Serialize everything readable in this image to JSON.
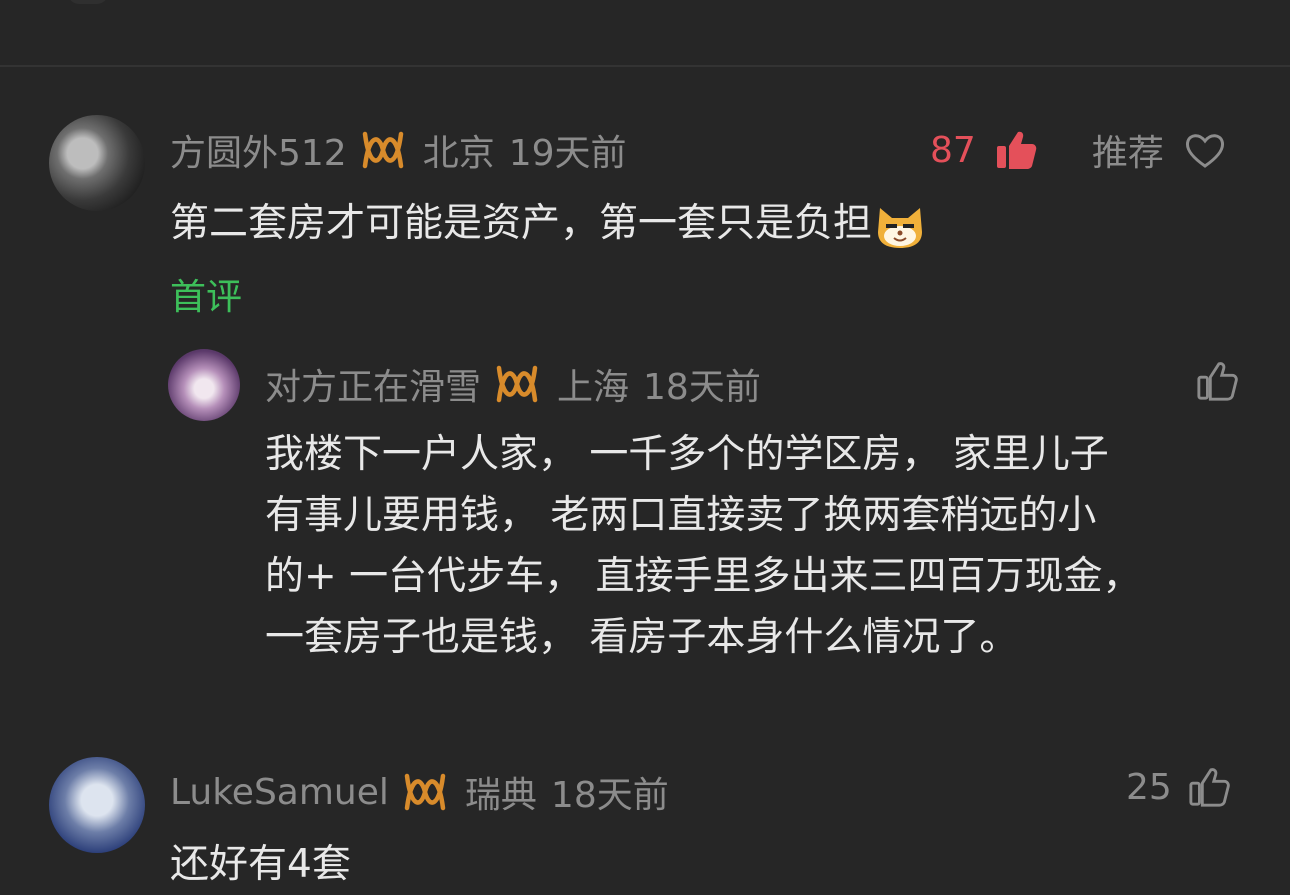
{
  "colors": {
    "background": "#262626",
    "meta_text": "#8c8c8c",
    "like_red": "#e4505a",
    "first_comment_green": "#3dbf5a"
  },
  "comments": [
    {
      "username": "方圆外512",
      "location": "北京",
      "time": "19天前",
      "likes": "87",
      "recommend_label": "推荐",
      "text": "第二套房才可能是资产，第一套只是负担",
      "badge": "首评",
      "replies": [
        {
          "username": "对方正在滑雪",
          "location": "上海",
          "time": "18天前",
          "lines": [
            "我楼下一户人家， 一千多个的学区房， 家里儿子",
            "有事儿要用钱， 老两口直接卖了换两套稍远的小",
            "的+ 一台代步车， 直接手里多出来三四百万现金，",
            "一套房子也是钱， 看房子本身什么情况了。"
          ]
        }
      ]
    },
    {
      "username": "LukeSamuel",
      "location": "瑞典",
      "time": "18天前",
      "likes": "25",
      "text": "还好有4套"
    }
  ],
  "icons": [
    "vip-badge-icon",
    "thumbs-up-filled-icon",
    "heart-outline-icon",
    "thumbs-up-outline-icon",
    "cat-emoji-icon"
  ]
}
